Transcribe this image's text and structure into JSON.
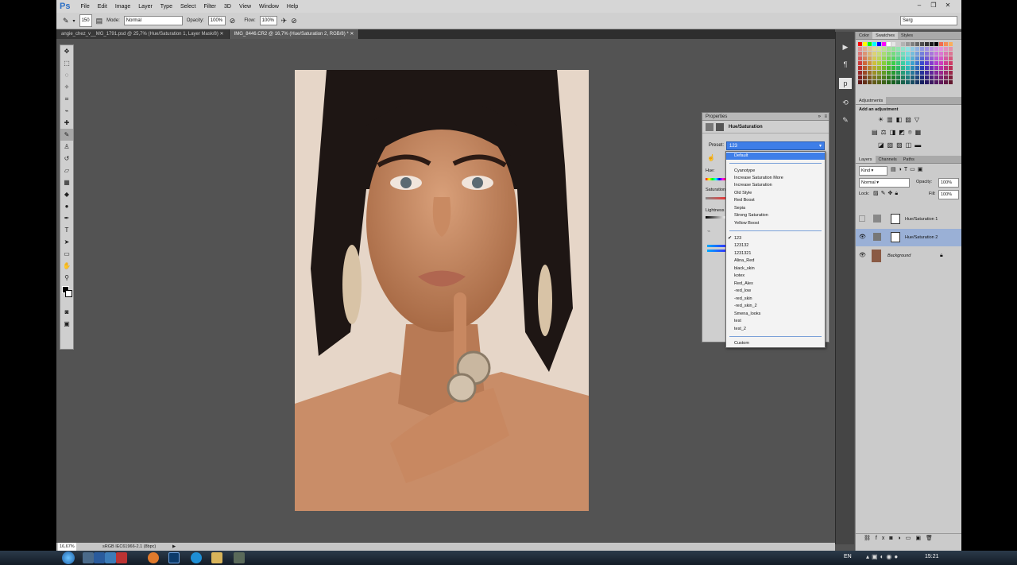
{
  "menubar": {
    "logo": "Ps",
    "items": [
      "File",
      "Edit",
      "Image",
      "Layer",
      "Type",
      "Select",
      "Filter",
      "3D",
      "View",
      "Window",
      "Help"
    ]
  },
  "options": {
    "brush_size": "150",
    "mode_label": "Mode:",
    "mode_value": "Normal",
    "opacity_label": "Opacity:",
    "opacity_value": "100%",
    "flow_label": "Flow:",
    "flow_value": "100%",
    "workspace": "Serg"
  },
  "tabs": [
    {
      "label": "angie_chez_v__MG_1791.psd @ 25,7% (Hue/Saturation 1, Layer Mask/8)",
      "active": false
    },
    {
      "label": "IMG_8446.CR2 @ 16,7% (Hue/Saturation 2, RGB/8) *",
      "active": true
    }
  ],
  "properties": {
    "title": "Properties",
    "adjustment_title": "Hue/Saturation",
    "preset_label": "Preset:",
    "preset_value": "123",
    "hue_label": "Hue:",
    "saturation_label": "Saturation",
    "lightness_label": "Lightness"
  },
  "preset_dropdown": {
    "default": "Default",
    "builtin": [
      "Cyanotype",
      "Increase Saturation More",
      "Increase Saturation",
      "Old Style",
      "Red Boost",
      "Sepia",
      "Strong Saturation",
      "Yellow Boost"
    ],
    "custom_presets": [
      "123",
      "123132",
      "1231321",
      "Alina_Red",
      "black_skin",
      "kotex",
      "Red_Alex",
      "-red_low",
      "-red_skin",
      "-red_skin_2",
      "Smena_looks",
      "test",
      "test_2"
    ],
    "checked": "123",
    "custom": "Custom"
  },
  "panels": {
    "color_tabs": [
      "Color",
      "Swatches",
      "Styles"
    ],
    "active_color_tab": "Swatches",
    "adjustments_title": "Adjustments",
    "add_adjustment": "Add an adjustment",
    "layer_tabs": [
      "Layers",
      "Channels",
      "Paths"
    ],
    "kind_label": "Kind",
    "blend_mode": "Normal",
    "opacity_label": "Opacity:",
    "opacity_value": "100%",
    "lock_label": "Lock:",
    "fill_label": "Fill:",
    "fill_value": "100%",
    "layers": [
      {
        "name": "Hue/Saturation 1",
        "visible": false,
        "selected": false
      },
      {
        "name": "Hue/Saturation 2",
        "visible": true,
        "selected": true
      },
      {
        "name": "Background",
        "visible": true,
        "selected": false
      }
    ]
  },
  "status": {
    "zoom": "16,67%",
    "profile": "sRGB IEC61966-2.1 (8bpc)"
  },
  "taskbar": {
    "lang": "EN",
    "time": "15:21"
  },
  "colors": {
    "selection": "#3e7ee8",
    "app_bg": "#535353"
  }
}
